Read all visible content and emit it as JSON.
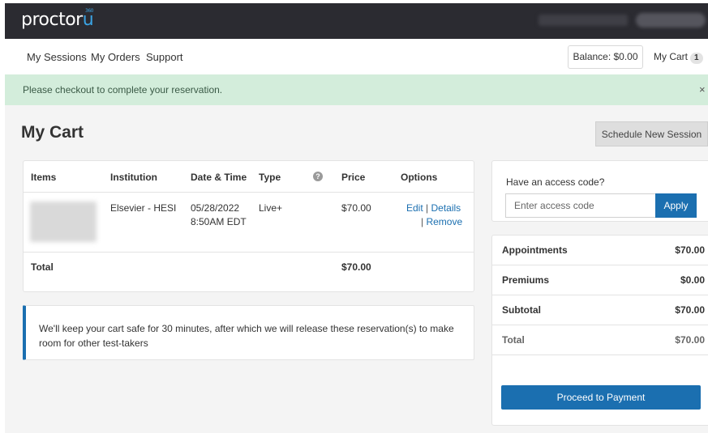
{
  "brand": {
    "logo_main": "proctor",
    "logo_u": "u",
    "logo_sub": "360"
  },
  "nav": {
    "links": [
      "My Sessions",
      "My Orders",
      "Support"
    ],
    "balance": "Balance: $0.00",
    "cart_label": "My Cart",
    "cart_count": "1"
  },
  "alert": {
    "message": "Please checkout to complete your reservation.",
    "close": "×"
  },
  "page": {
    "title": "My Cart",
    "schedule_button": "Schedule New Session"
  },
  "cart": {
    "headers": {
      "items": "Items",
      "institution": "Institution",
      "datetime": "Date & Time",
      "type": "Type",
      "help": "?",
      "price": "Price",
      "options": "Options"
    },
    "rows": [
      {
        "institution": "Elsevier - HESI",
        "date": "05/28/2022",
        "time": "8:50AM EDT",
        "type": "Live+",
        "price": "$70.00",
        "edit": "Edit",
        "details": "Details",
        "remove": "Remove",
        "sep": "|"
      }
    ],
    "total_label": "Total",
    "total_value": "$70.00"
  },
  "note": {
    "text": "We'll keep your cart safe for 30 minutes, after which we will release these reservation(s) to make room for other test-takers"
  },
  "access_code": {
    "label": "Have an access code?",
    "placeholder": "Enter access code",
    "apply": "Apply"
  },
  "summary": {
    "rows": [
      {
        "label": "Appointments",
        "value": "$70.00"
      },
      {
        "label": "Premiums",
        "value": "$0.00"
      },
      {
        "label": "Subtotal",
        "value": "$70.00"
      },
      {
        "label": "Total",
        "value": "$70.00"
      }
    ],
    "pay_button": "Proceed to Payment"
  },
  "colors": {
    "topbar": "#2b2b31",
    "accent": "#1b6fb0",
    "alert_bg": "#d3eddb"
  }
}
